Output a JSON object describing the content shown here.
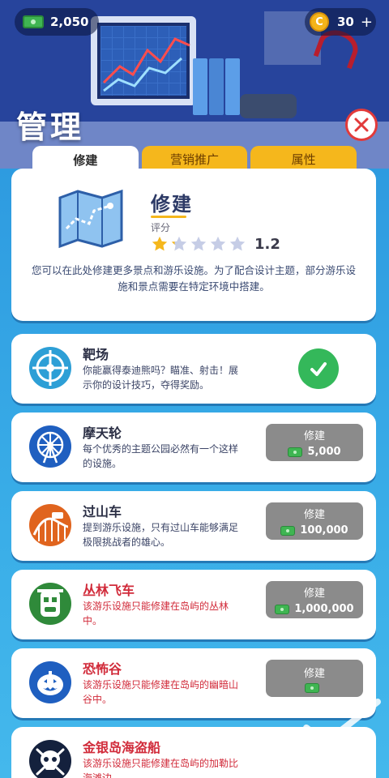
{
  "currency": {
    "cash": "2,050",
    "coins": "30",
    "coin_plus": "+",
    "coin_symbol": "C"
  },
  "page_title": "管理",
  "tabs": [
    {
      "label": "修建",
      "active": true
    },
    {
      "label": "营销推广",
      "active": false
    },
    {
      "label": "属性",
      "active": false
    }
  ],
  "detail": {
    "title": "修建",
    "rating_label": "评分",
    "rating_value": "1.2",
    "rating_stars": 1.2,
    "description": "您可以在此处修建更多景点和游乐设施。为了配合设计主题，部分游乐设施和景点需要在特定环境中搭建。"
  },
  "items": [
    {
      "name": "靶场",
      "desc": "你能赢得泰迪熊吗？瞄准、射击！展示你的设计技巧，夺得奖励。",
      "built": true,
      "locked": false,
      "icon": "target-icon",
      "icon_color": "#2d9fd6"
    },
    {
      "name": "摩天轮",
      "desc": "每个优秀的主题公园必然有一个这样的设施。",
      "built": false,
      "locked": false,
      "button_label": "修建",
      "price": "5,000",
      "icon": "ferris-wheel-icon",
      "icon_color": "#1f5fc0"
    },
    {
      "name": "过山车",
      "desc": "提到游乐设施，只有过山车能够满足极限挑战者的雄心。",
      "built": false,
      "locked": false,
      "button_label": "修建",
      "price": "100,000",
      "icon": "roller-coaster-icon",
      "icon_color": "#e0641e"
    },
    {
      "name": "丛林飞车",
      "desc": "该游乐设施只能修建在岛屿的丛林中。",
      "built": false,
      "locked": true,
      "button_label": "修建",
      "price": "1,000,000",
      "icon": "jungle-mask-icon",
      "icon_color": "#2f8a3a"
    },
    {
      "name": "恐怖谷",
      "desc": "该游乐设施只能修建在岛屿的幽暗山谷中。",
      "built": false,
      "locked": true,
      "button_label": "修建",
      "price": "",
      "icon": "pumpkin-icon",
      "icon_color": "#1f5fc0"
    },
    {
      "name": "金银岛海盗船",
      "desc": "该游乐设施只能修建在岛屿的加勒比海滩边。",
      "built": false,
      "locked": true,
      "icon": "skull-icon",
      "icon_color": "#14213d"
    }
  ],
  "colors": {
    "accent": "#f5b71c",
    "panel": "#3aaee8",
    "locked_text": "#d12b3a",
    "done": "#34b85a"
  }
}
